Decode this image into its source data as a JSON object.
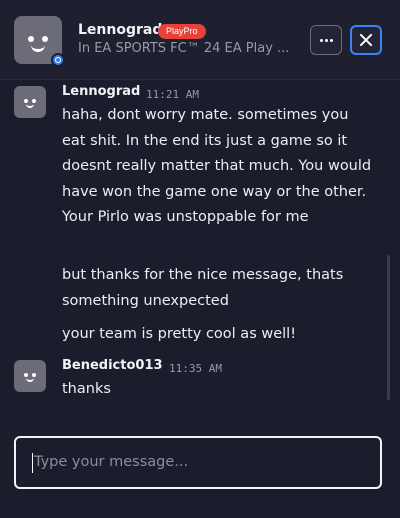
{
  "header": {
    "name": "Lennograd",
    "badge": "PlayPro",
    "status": "In EA SPORTS FC™ 24 EA Play ..."
  },
  "messages": [
    {
      "author": "Lennograd",
      "time": "11:21 AM",
      "paragraphs": [
        "haha, dont worry mate. sometimes you eat shit. In the end its just a game so it doesnt really matter that much. You would have won the game one way or the other. Your Pirlo was unstoppable for me",
        "but thanks for the nice message, thats something unexpected",
        "your team is pretty cool as well!"
      ]
    },
    {
      "author": "Benedicto013",
      "time": "11:35 AM",
      "paragraphs": [
        "thanks"
      ]
    }
  ],
  "composer": {
    "placeholder": "Type your message..."
  },
  "icons": {
    "more": "more-options-icon",
    "close": "close-icon",
    "status": "online-status-icon"
  },
  "colors": {
    "accent": "#3b82f6",
    "badge": "#e8413a",
    "background": "#1c1d2c"
  }
}
